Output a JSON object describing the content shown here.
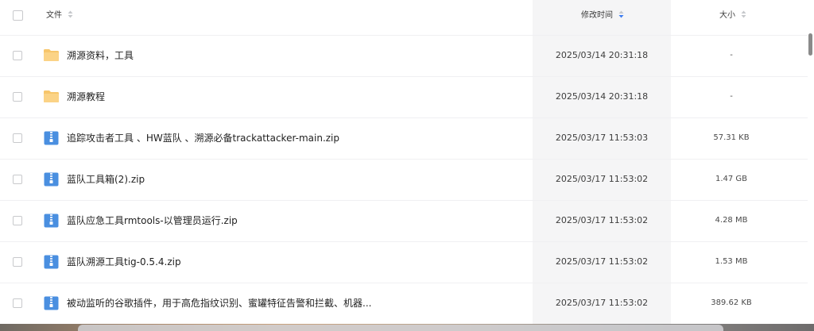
{
  "header": {
    "file_label": "文件",
    "time_label": "修改时间",
    "size_label": "大小"
  },
  "rows": [
    {
      "type": "folder",
      "name": "溯源资料，工具",
      "time": "2025/03/14 20:31:18",
      "size": "-"
    },
    {
      "type": "folder",
      "name": "溯源教程",
      "time": "2025/03/14 20:31:18",
      "size": "-"
    },
    {
      "type": "zip",
      "name": "追踪攻击者工具 、HW蓝队 、溯源必备trackattacker-main.zip",
      "time": "2025/03/17 11:53:03",
      "size": "57.31 KB"
    },
    {
      "type": "zip",
      "name": "蓝队工具箱(2).zip",
      "time": "2025/03/17 11:53:02",
      "size": "1.47 GB"
    },
    {
      "type": "zip",
      "name": "蓝队应急工具rmtools-以管理员运行.zip",
      "time": "2025/03/17 11:53:02",
      "size": "4.28 MB"
    },
    {
      "type": "zip",
      "name": "蓝队溯源工具tig-0.5.4.zip",
      "time": "2025/03/17 11:53:02",
      "size": "1.53 MB"
    },
    {
      "type": "zip",
      "name": "被动监听的谷歌插件，用于高危指纹识别、蜜罐特征告警和拦截、机器...",
      "time": "2025/03/17 11:53:02",
      "size": "389.62 KB"
    }
  ],
  "colors": {
    "folder": "#f7c66b",
    "zip": "#4a8fe0",
    "sort_active": "#3d7cf2",
    "sort_inactive": "#c6c8cc",
    "sorted_column_bg": "#f5f5f6"
  },
  "icons": {
    "folder": "folder-icon",
    "zip": "zip-file-icon",
    "sort": "sort-icon"
  }
}
